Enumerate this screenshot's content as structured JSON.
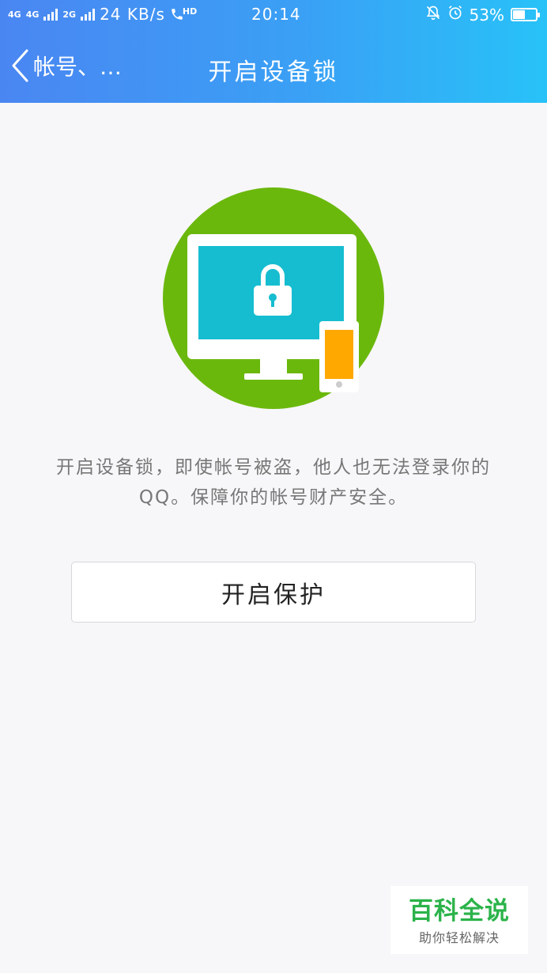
{
  "status_bar": {
    "network_1": "4G",
    "network_2": "4G",
    "network_3": "2G",
    "speed": "24 KB/s",
    "hd_label": "HD",
    "time": "20:14",
    "battery": "53%",
    "battery_level": 0.53
  },
  "navbar": {
    "back_label": "帐号、…",
    "title": "开启设备锁"
  },
  "hero": {
    "icon": "device-lock-illustration",
    "colors": {
      "circle": "#6bb80d",
      "monitor": "#ffffff",
      "screen": "#16bdd0",
      "phone_screen": "#ffa800"
    }
  },
  "description": {
    "line1": "开启设备锁，即使帐号被盗，他人也无法登录你的",
    "line2": "QQ。保障你的帐号财产安全。"
  },
  "action": {
    "enable_label": "开启保护"
  },
  "watermark": {
    "brand": "百科全说",
    "slogan": "助你轻松解决"
  }
}
